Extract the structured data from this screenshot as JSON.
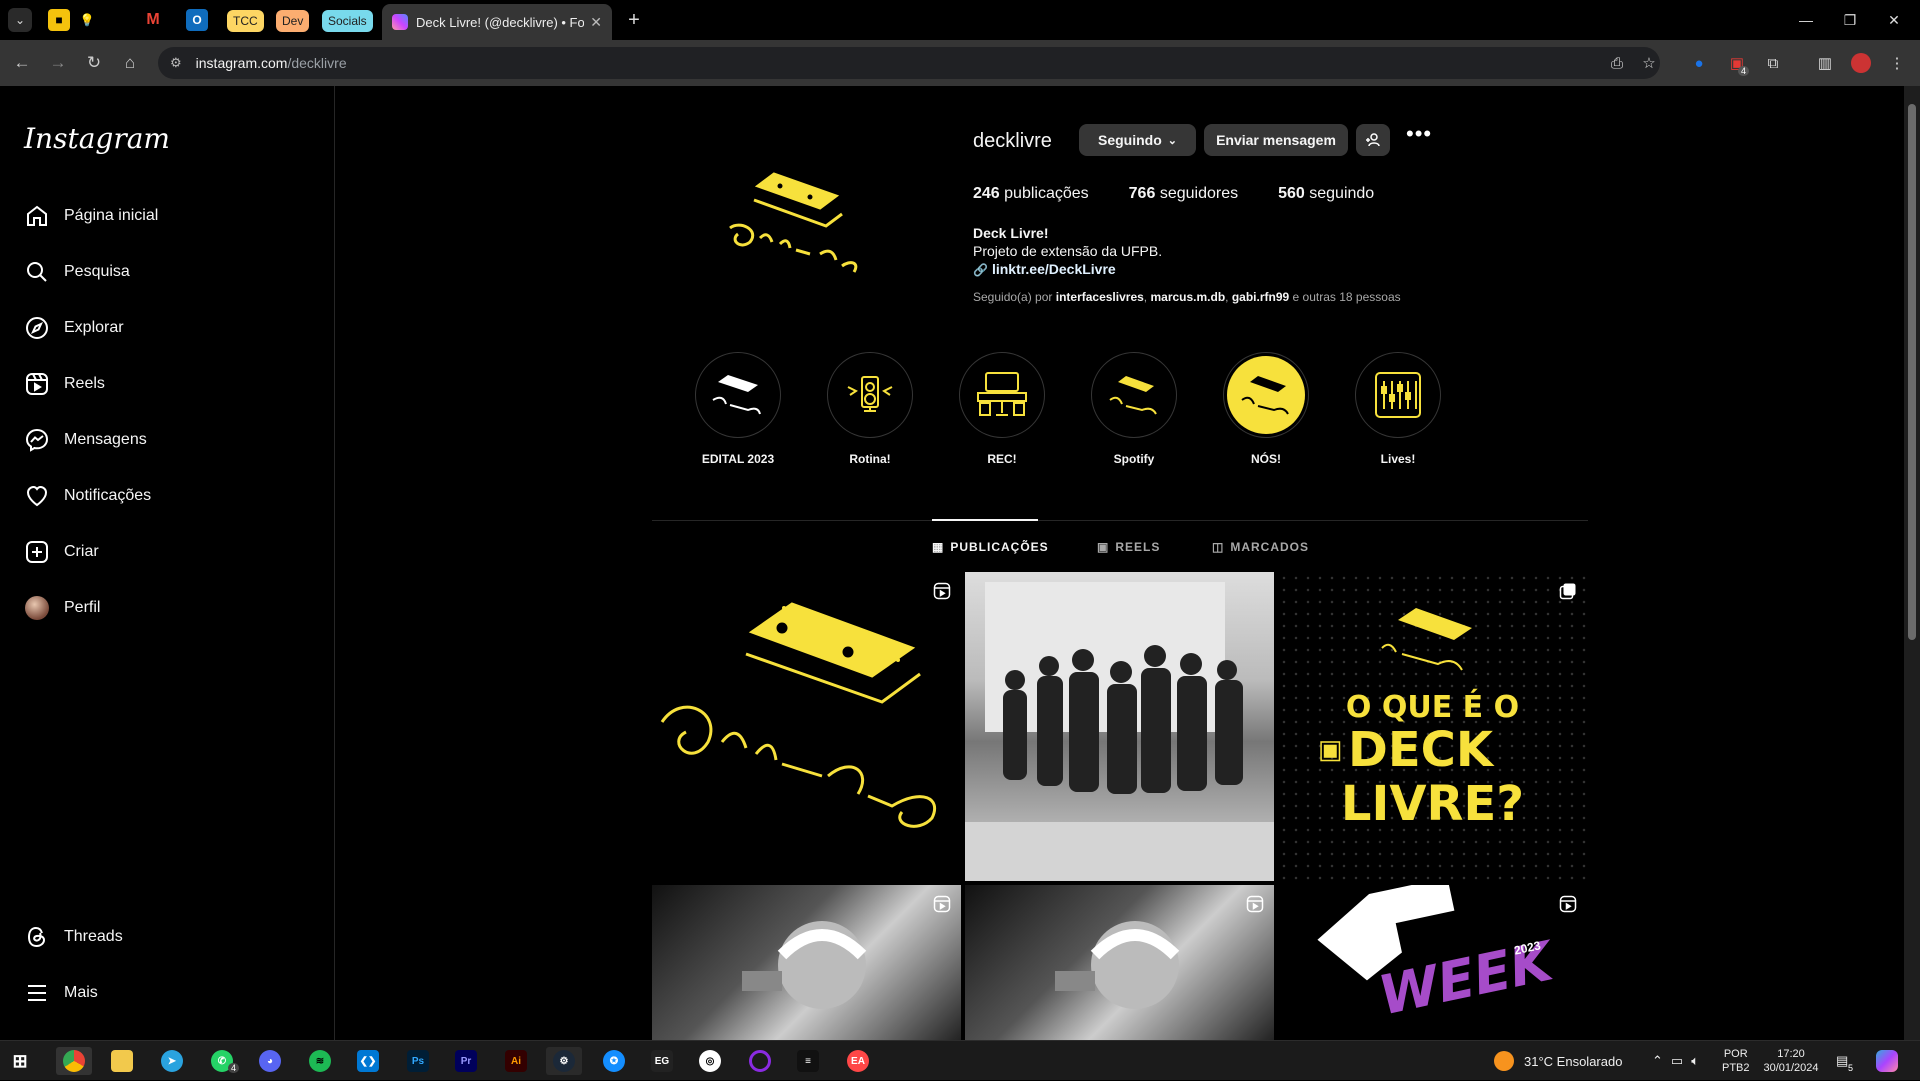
{
  "browser": {
    "pinned_groups": [
      "TCC",
      "Dev",
      "Socials"
    ],
    "active_tab_title": "Deck Livre! (@decklivre) • Fotos",
    "url_host": "instagram.com",
    "url_path": "/decklivre",
    "extension_badge": "4"
  },
  "sidebar": {
    "logo": "Instagram",
    "items": [
      {
        "label": "Página inicial",
        "icon": "home-icon"
      },
      {
        "label": "Pesquisa",
        "icon": "search-icon"
      },
      {
        "label": "Explorar",
        "icon": "compass-icon"
      },
      {
        "label": "Reels",
        "icon": "reels-icon"
      },
      {
        "label": "Mensagens",
        "icon": "messenger-icon"
      },
      {
        "label": "Notificações",
        "icon": "heart-icon"
      },
      {
        "label": "Criar",
        "icon": "plus-square-icon"
      },
      {
        "label": "Perfil",
        "icon": "avatar"
      }
    ],
    "bottom_items": [
      {
        "label": "Threads",
        "icon": "threads-icon"
      },
      {
        "label": "Mais",
        "icon": "menu-icon"
      }
    ]
  },
  "profile": {
    "username": "decklivre",
    "following_button": "Seguindo",
    "message_button": "Enviar mensagem",
    "posts_count": "246",
    "posts_label": "publicações",
    "followers_count": "766",
    "followers_label": "seguidores",
    "following_count": "560",
    "following_label": "seguindo",
    "display_name": "Deck Livre!",
    "bio": "Projeto de extensão da UFPB.",
    "link": "linktr.ee/DeckLivre",
    "followed_prefix": "Seguido(a) por",
    "followed_by": [
      "interfaceslivres",
      "marcus.m.db",
      "gabi.rfn99"
    ],
    "followed_suffix": "e outras 18 pessoas"
  },
  "highlights": [
    "EDITAL 2023",
    "Rotina!",
    "REC!",
    "Spotify",
    "NÓS!",
    "Lives!"
  ],
  "tabs": {
    "posts": "PUBLICAÇÕES",
    "reels": "REELS",
    "tagged": "MARCADOS"
  },
  "posts": {
    "p3_line1": "O QUE É O",
    "p3_line2": "DECK",
    "p3_line3": "LIVRE?",
    "p6_line1": "WEEK",
    "p6_line2": "2023"
  },
  "colors": {
    "brand_yellow": "#f7e13c",
    "bg": "#000000",
    "button_bg": "#363636"
  },
  "taskbar": {
    "weather_temp": "31°C",
    "weather_desc": "Ensolarado",
    "lang_line1": "POR",
    "lang_line2": "PTB2",
    "time": "17:20",
    "date": "30/01/2024",
    "notif_count": "5",
    "whatsapp_badge": "4"
  }
}
